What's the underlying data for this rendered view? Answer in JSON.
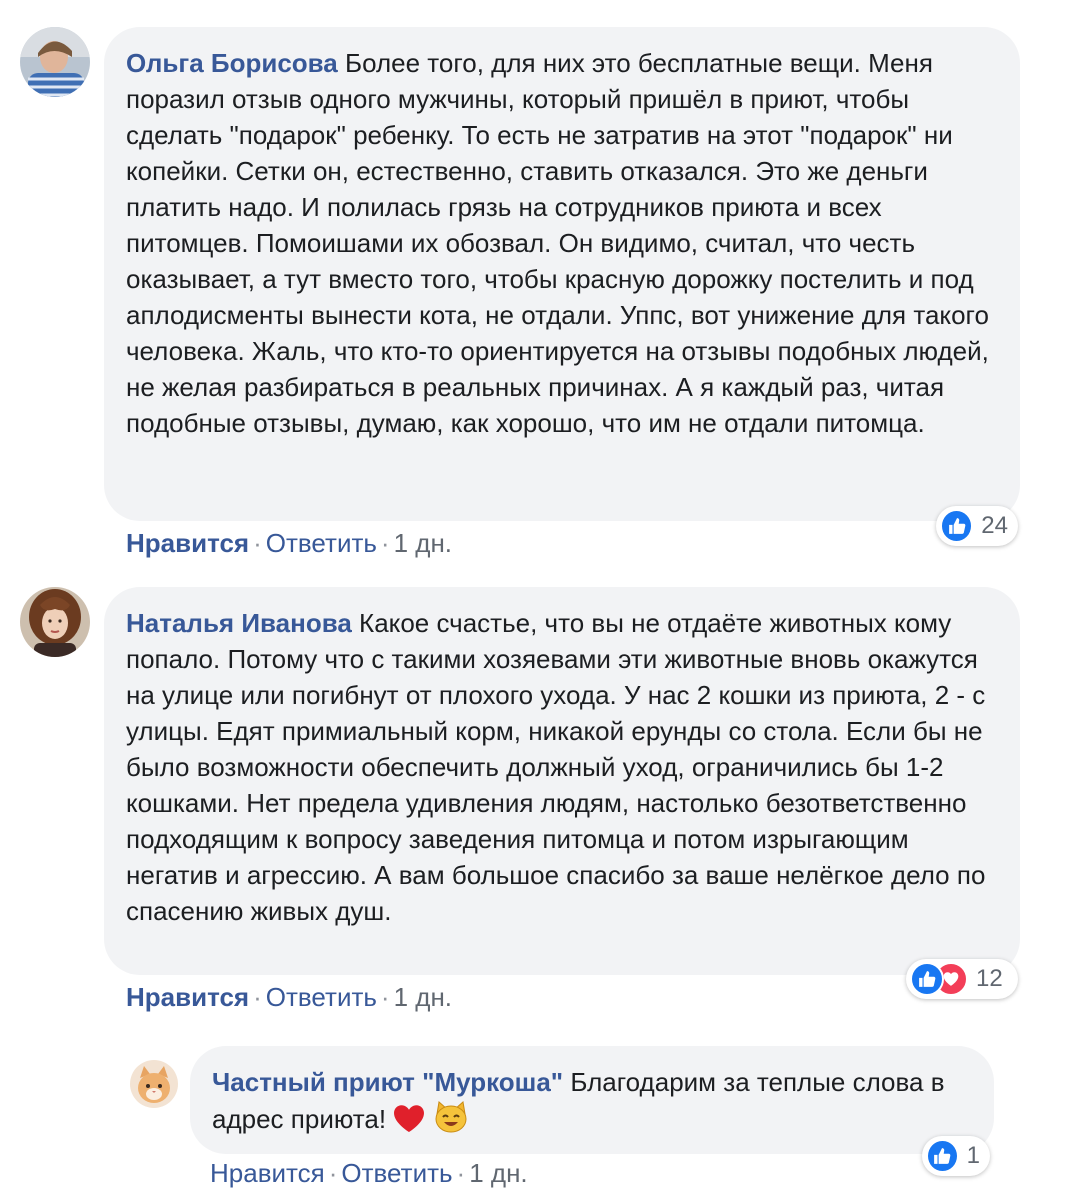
{
  "comments": [
    {
      "author": "Ольга Борисова",
      "text": "Более того, для них это бесплатные вещи. Меня поразил отзыв одного мужчины, который пришёл в приют, чтобы сделать \"подарок\" ребенку. То есть не затратив на этот \"подарок\" ни копейки. Сетки он, естественно, ставить отказался. Это же деньги платить надо. И полилась грязь на сотрудников приюта и всех питомцев. Помоишами их обозвал. Он видимо, считал, что честь оказывает, а тут вместо того, чтобы красную дорожку постелить и под аплодисменты вынести кота, не отдали. Уппс, вот унижение для такого человека. Жаль, что кто-то ориентируется на отзывы подобных людей, не желая разбираться в реальных причинах. А я каждый раз, читая подобные отзывы, думаю, как хорошо, что им не отдали питомца.",
      "like_label": "Нравится",
      "reply_label": "Ответить",
      "time": "1 дн.",
      "reaction_count": "24"
    },
    {
      "author": "Наталья Иванова",
      "text": "Какое счастье, что вы не отдаёте животных кому попало. Потому что с такими хозяевами эти животные вновь окажутся на улице или погибнут от плохого ухода. У нас 2 кошки из приюта, 2 - с улицы. Едят примиальный корм, никакой ерунды со стола. Если бы не было возможности обеспечить должный уход, ограничились бы 1-2 кошками. Нет предела удивления людям, настолько безответственно подходящим к вопросу заведения питомца и потом изрыгающим негатив и агрессию. А вам большое спасибо за ваше нелёгкое дело по спасению живых душ.",
      "like_label": "Нравится",
      "reply_label": "Ответить",
      "time": "1 дн.",
      "reaction_count": "12"
    }
  ],
  "reply": {
    "author": "Частный приют \"Муркоша\"",
    "text": "Благодарим за теплые слова в адрес приюта!",
    "like_label": "Нравится",
    "reply_label": "Ответить",
    "time": "1 дн.",
    "reaction_count": "1"
  },
  "colors": {
    "link": "#385898",
    "bubble": "#f2f3f5",
    "like_blue": "#1877f2",
    "love_red": "#f33e58"
  },
  "icons": [
    "avatar-olga",
    "avatar-natalya",
    "avatar-shelter-cat",
    "like-reaction-icon",
    "love-reaction-icon",
    "red-heart-emoji",
    "smiling-cat-emoji"
  ]
}
